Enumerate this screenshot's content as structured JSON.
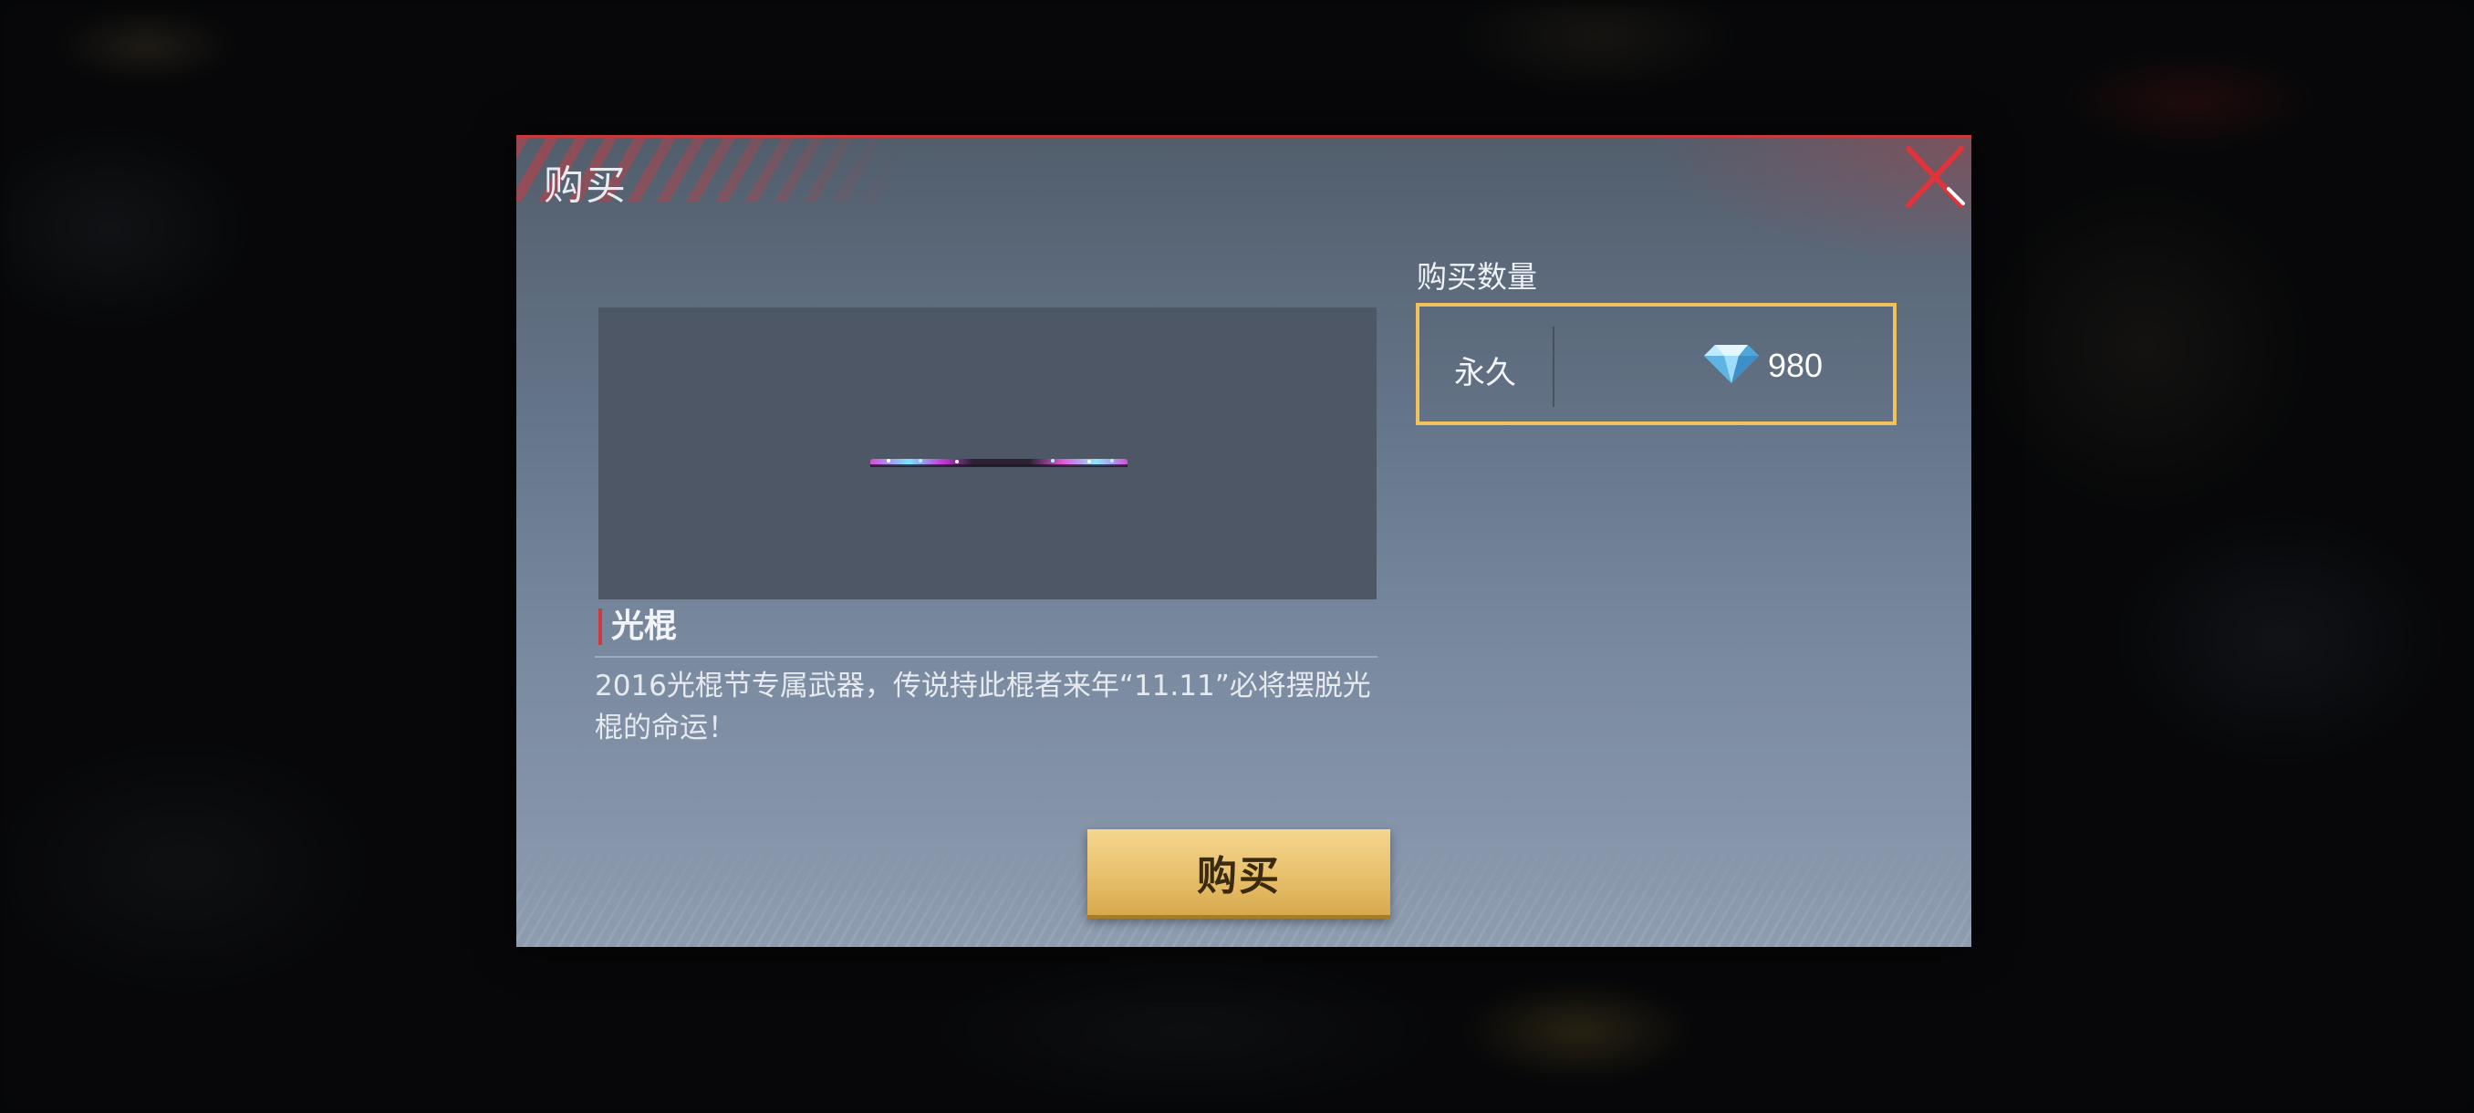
{
  "dialog": {
    "title": "购买",
    "close_icon": "close-icon"
  },
  "item": {
    "name": "光棍",
    "description": "2016光棍节专属武器，传说持此棍者来年“11.11”必将摆脱光棍的命运！",
    "image": "glowing-staff-weapon"
  },
  "quantity": {
    "label": "购买数量",
    "options": [
      {
        "label": "永久",
        "currency_icon": "diamond-icon",
        "price": "980",
        "selected": true
      }
    ]
  },
  "actions": {
    "buy_label": "购买"
  },
  "colors": {
    "accent_red": "#c8383d",
    "selected_border": "#f0c15c",
    "buy_button": "#e8c06b"
  }
}
